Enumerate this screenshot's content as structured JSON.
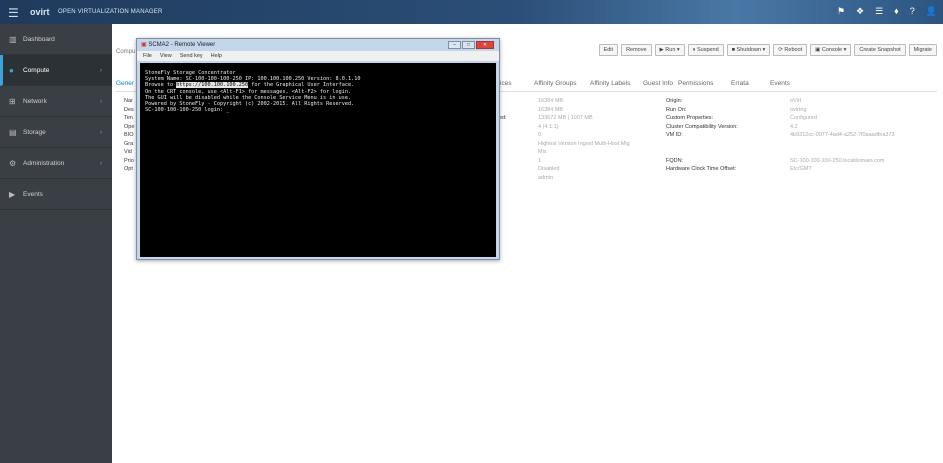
{
  "topbar": {
    "brand": "ovirt",
    "product": "OPEN VIRTUALIZATION MANAGER",
    "icons": [
      "flag-icon",
      "bookmark-icon",
      "tasks-icon",
      "bell-icon",
      "help-icon",
      "user-icon"
    ],
    "icon_glyphs": [
      "⚑",
      "❖",
      "☰",
      "♦",
      "?",
      "👤"
    ]
  },
  "sidebar": {
    "items": [
      {
        "label": "Dashboard",
        "icon": "dashboard-icon",
        "glyph": "▥",
        "chev": ""
      },
      {
        "label": "Compute",
        "icon": "compute-icon",
        "glyph": "●",
        "chev": "›",
        "active": true
      },
      {
        "label": "Network",
        "icon": "network-icon",
        "glyph": "⊞",
        "chev": "›"
      },
      {
        "label": "Storage",
        "icon": "storage-icon",
        "glyph": "▤",
        "chev": "›"
      },
      {
        "label": "Administration",
        "icon": "administration-icon",
        "glyph": "⚙",
        "chev": "›"
      },
      {
        "label": "Events",
        "icon": "events-icon",
        "glyph": "▶",
        "chev": ""
      }
    ]
  },
  "breadcrumb": "Compu",
  "actions": [
    "Edit",
    "Remove",
    "▶ Run ▾",
    "⏸ Suspend",
    "■ Shutdown ▾",
    "⟳ Reboot",
    "▣ Console ▾",
    "Create Snapshot",
    "Migrate"
  ],
  "tabs": [
    "Gener",
    "ices",
    "Affinity Groups",
    "Affinity Labels",
    "Guest Info",
    "Permissions",
    "Errata",
    "Events"
  ],
  "details": {
    "left_labels": [
      "Nar",
      "Des",
      "Ten",
      "Ope",
      "BIO",
      "Gra",
      "Vid",
      "Prio",
      "Opt"
    ],
    "mid_label": "eed:",
    "mid_values": [
      "16384 MB",
      "16384 MB",
      "133672 MB | 1007 MB",
      "4 (4:1:1)",
      "0",
      "Highest Version Ingest Multi-Host Mig",
      "Mix",
      "1",
      "Disabled",
      "admin"
    ],
    "right_labels": [
      "Origin:",
      "Run On:",
      "Custom Properties:",
      "Cluster Compatibility Version:",
      "VM ID:",
      "",
      "",
      "FQDN:",
      "Hardware Clock Time Offset:"
    ],
    "right_values": [
      "oVirt",
      "ovirtng",
      "Configured",
      "4.2",
      "4b9312cc-0077-4ad4-a252-7f0aaadfea373",
      "",
      "",
      "SC-100-100-100-250.localdomain.com",
      "Etc/GMT"
    ]
  },
  "remote_viewer": {
    "title": "SCMA2 - Remote Viewer",
    "menu": [
      "File",
      "View",
      "Send key",
      "Help"
    ],
    "controls": [
      "–",
      "□",
      "✕"
    ],
    "console": {
      "line1": "StoneFly Storage Concentrator",
      "line2": "System Name: SC-100-100-100-250   IP: 100.100.100.250   Version: 8.0.1.10",
      "line3_pre": "Browse to ",
      "line3_url": "https://100.100.100.250",
      "line3_post": " for the Graphical User Interface.",
      "line4": "On the CRT console, use <Alt-F1> for messages, <Alt-F2> for login.",
      "line5": "The GUI will be disabled while the Console Service Menu is in use.",
      "line6": "Powered by StoneFly - Copyright (c) 2002-2015. All Rights Reserved.",
      "line7": "SC-100-100-100-250 login: _"
    }
  }
}
